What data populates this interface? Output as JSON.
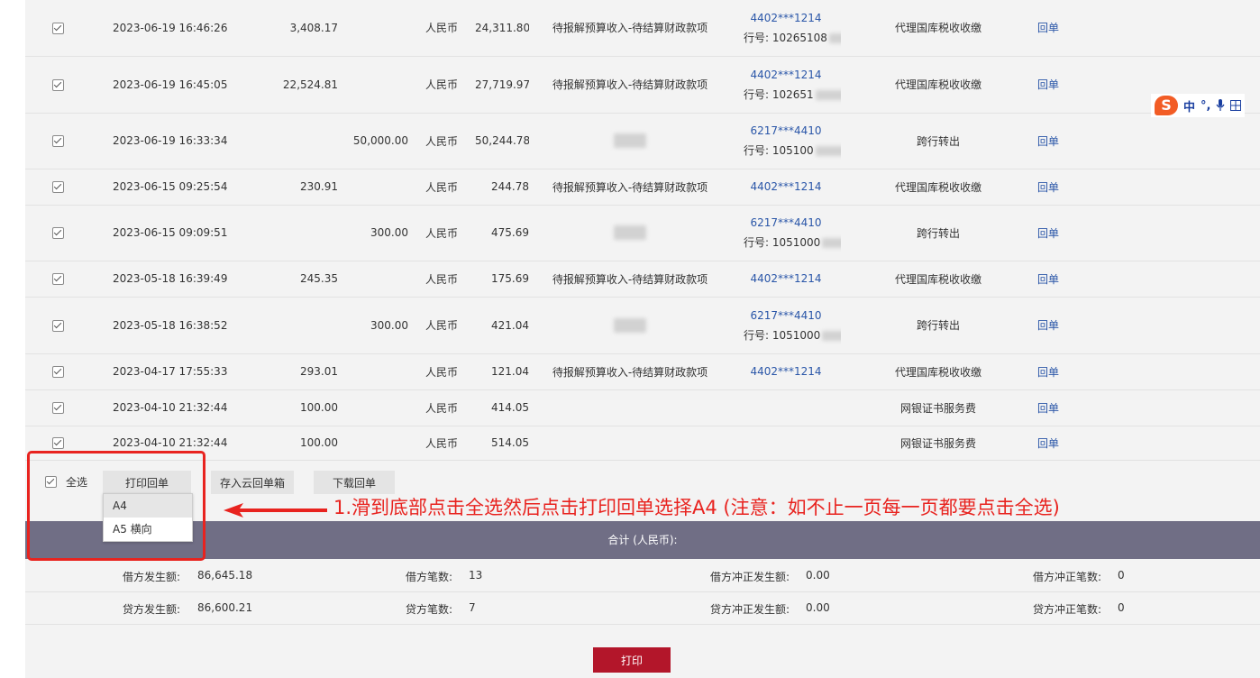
{
  "rows": [
    {
      "time": "2023-06-19  16:46:26",
      "debit": "3,408.17",
      "credit": "",
      "currency": "人民币",
      "balance": "24,311.80",
      "summary": "待报解预算收入-待结算财政款项",
      "account": "4402***1214",
      "bank": "行号: 10265108",
      "type": "代理国库税收收缴",
      "receipt": "回单"
    },
    {
      "time": "2023-06-19  16:45:05",
      "debit": "22,524.81",
      "credit": "",
      "currency": "人民币",
      "balance": "27,719.97",
      "summary": "待报解预算收入-待结算财政款项",
      "account": "4402***1214",
      "bank": "行号: 102651",
      "type": "代理国库税收收缴",
      "receipt": "回单"
    },
    {
      "time": "2023-06-19  16:33:34",
      "debit": "",
      "credit": "50,000.00",
      "currency": "人民币",
      "balance": "50,244.78",
      "summary": "",
      "account": "6217***4410",
      "bank": "行号: 105100",
      "type": "跨行转出",
      "receipt": "回单"
    },
    {
      "time": "2023-06-15  09:25:54",
      "debit": "230.91",
      "credit": "",
      "currency": "人民币",
      "balance": "244.78",
      "summary": "待报解预算收入-待结算财政款项",
      "account": "4402***1214",
      "bank": "",
      "type": "代理国库税收收缴",
      "receipt": "回单"
    },
    {
      "time": "2023-06-15  09:09:51",
      "debit": "",
      "credit": "300.00",
      "currency": "人民币",
      "balance": "475.69",
      "summary": "",
      "account": "6217***4410",
      "bank": "行号: 1051000",
      "type": "跨行转出",
      "receipt": "回单"
    },
    {
      "time": "2023-05-18  16:39:49",
      "debit": "245.35",
      "credit": "",
      "currency": "人民币",
      "balance": "175.69",
      "summary": "待报解预算收入-待结算财政款项",
      "account": "4402***1214",
      "bank": "",
      "type": "代理国库税收收缴",
      "receipt": "回单"
    },
    {
      "time": "2023-05-18  16:38:52",
      "debit": "",
      "credit": "300.00",
      "currency": "人民币",
      "balance": "421.04",
      "summary": "",
      "account": "6217***4410",
      "bank": "行号: 1051000",
      "type": "跨行转出",
      "receipt": "回单"
    },
    {
      "time": "2023-04-17  17:55:33",
      "debit": "293.01",
      "credit": "",
      "currency": "人民币",
      "balance": "121.04",
      "summary": "待报解预算收入-待结算财政款项",
      "account": "4402***1214",
      "bank": "",
      "type": "代理国库税收收缴",
      "receipt": "回单"
    },
    {
      "time": "2023-04-10  21:32:44",
      "debit": "100.00",
      "credit": "",
      "currency": "人民币",
      "balance": "414.05",
      "summary": "",
      "account": "",
      "bank": "",
      "type": "网银证书服务费",
      "receipt": "回单"
    },
    {
      "time": "2023-04-10  21:32:44",
      "debit": "100.00",
      "credit": "",
      "currency": "人民币",
      "balance": "514.05",
      "summary": "",
      "account": "",
      "bank": "",
      "type": "网银证书服务费",
      "receipt": "回单"
    }
  ],
  "actions": {
    "select_all": "全选",
    "print_receipt": "打印回单",
    "save_cloud": "存入云回单箱",
    "download": "下载回单"
  },
  "dropdown": [
    "A4",
    "A5 横向"
  ],
  "annotation": "1.滑到底部点击全选然后点击打印回单选择A4 (注意：如不止一页每一页都要点击全选)",
  "totals": {
    "title": "合计 (人民币):",
    "debit_amount_label": "借方发生额:",
    "debit_amount": "86,645.18",
    "debit_count_label": "借方笔数:",
    "debit_count": "13",
    "debit_reversal_amount_label": "借方冲正发生额:",
    "debit_reversal_amount": "0.00",
    "debit_reversal_count_label": "借方冲正笔数:",
    "debit_reversal_count": "0",
    "credit_amount_label": "贷方发生额:",
    "credit_amount": "86,600.21",
    "credit_count_label": "贷方笔数:",
    "credit_count": "7",
    "credit_reversal_amount_label": "贷方冲正发生额:",
    "credit_reversal_amount": "0.00",
    "credit_reversal_count_label": "贷方冲正笔数:",
    "credit_reversal_count": "0"
  },
  "print_button": "打印",
  "ime": {
    "mode": "中",
    "punct": "°,"
  },
  "colors": {
    "accent_red": "#b3162a",
    "annotation_red": "#e8231f",
    "total_bar": "#706e85",
    "link_blue": "#2a56a8"
  }
}
